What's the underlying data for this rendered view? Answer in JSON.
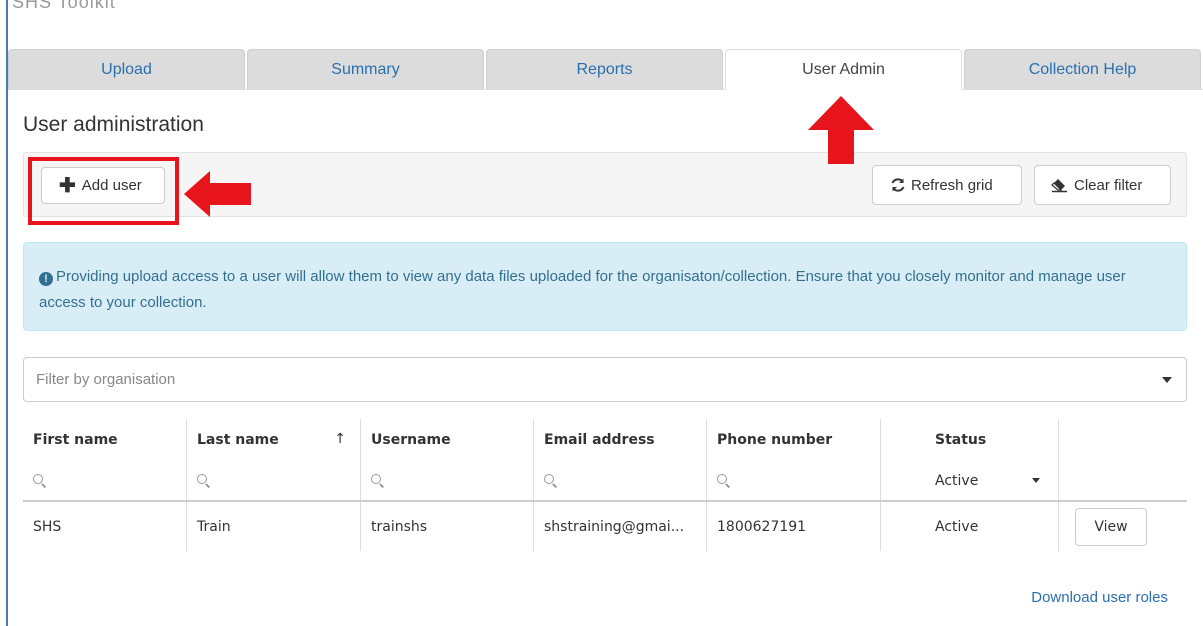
{
  "app": {
    "title": "SHS Toolkit"
  },
  "tabs": [
    {
      "label": "Upload"
    },
    {
      "label": "Summary"
    },
    {
      "label": "Reports"
    },
    {
      "label": "User Admin",
      "active": true
    },
    {
      "label": "Collection Help"
    }
  ],
  "page": {
    "title": "User administration"
  },
  "toolbar": {
    "add_label": "Add user",
    "refresh_label": "Refresh grid",
    "clear_label": "Clear filter"
  },
  "alert": {
    "text": "Providing upload access to a user will allow them to view any data files uploaded for the organisaton/collection. Ensure that you closely monitor and manage user access to your collection."
  },
  "filter": {
    "placeholder": "Filter by organisation"
  },
  "grid": {
    "headers": [
      "First name",
      "Last name",
      "Username",
      "Email address",
      "Phone number",
      "Status",
      ""
    ],
    "sort_indicator": "↑",
    "status_filter": "Active",
    "rows": [
      {
        "first": "SHS",
        "last": "Train",
        "username": "trainshs",
        "email": "shstraining@gmai...",
        "phone": "1800627191",
        "status": "Active",
        "action": "View"
      }
    ]
  },
  "footer": {
    "download_label": "Download user roles"
  },
  "colors": {
    "accent": "#2a6fb0",
    "highlight": "#e8141b",
    "alert_bg": "#d9edf7"
  },
  "icons": [
    "plus-icon",
    "refresh-icon",
    "eraser-icon",
    "info-icon",
    "search-icon",
    "chevron-down-icon",
    "sort-up-icon"
  ]
}
